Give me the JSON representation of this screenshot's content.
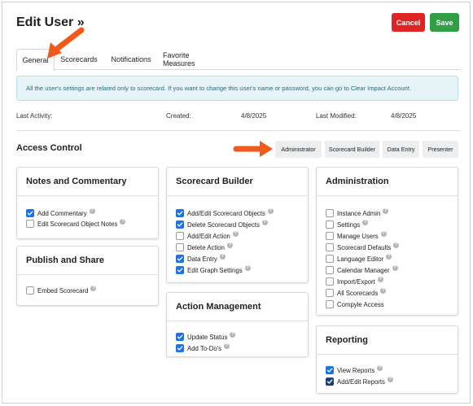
{
  "header": {
    "title": "Edit User »",
    "cancel_label": "Cancel",
    "save_label": "Save"
  },
  "tabs": [
    {
      "label": "General",
      "active": true
    },
    {
      "label": "Scorecards",
      "active": false
    },
    {
      "label": "Notifications",
      "active": false
    },
    {
      "label": "Favorite Measures",
      "active": false
    }
  ],
  "info_text": "All the user's settings are related only to scorecard. If you want to change this user's name or password, you can go to Clear Impact Account.",
  "meta": {
    "last_activity_label": "Last Activity:",
    "created_label": "Created:",
    "created_value": "4/8/2025",
    "last_modified_label": "Last Modified:",
    "last_modified_value": "4/8/2025"
  },
  "access_control": {
    "title": "Access Control",
    "roles": [
      "Administrator",
      "Scorecard Builder",
      "Data Entry",
      "Presenter"
    ]
  },
  "cards": {
    "notes": {
      "title": "Notes and Commentary",
      "items": [
        {
          "label": "Add Commentary",
          "checked": true
        },
        {
          "label": "Edit Scorecard Object Notes",
          "checked": false
        }
      ]
    },
    "publish": {
      "title": "Publish and Share",
      "items": [
        {
          "label": "Embed Scorecard",
          "checked": false
        }
      ]
    },
    "builder": {
      "title": "Scorecard Builder",
      "items": [
        {
          "label": "Add/Edit Scorecard Objects",
          "checked": true
        },
        {
          "label": "Delete Scorecard Objects",
          "checked": true
        },
        {
          "label": "Add/Edit Action",
          "checked": false
        },
        {
          "label": "Delete Action",
          "checked": false
        },
        {
          "label": "Data Entry",
          "checked": true
        },
        {
          "label": "Edit Graph Settings",
          "checked": true
        }
      ]
    },
    "action": {
      "title": "Action Management",
      "items": [
        {
          "label": "Update Status",
          "checked": true
        },
        {
          "label": "Add To-Do's",
          "checked": true
        }
      ]
    },
    "admin": {
      "title": "Administration",
      "items": [
        {
          "label": "Instance Admin",
          "checked": false
        },
        {
          "label": "Settings",
          "checked": false
        },
        {
          "label": "Manage Users",
          "checked": false
        },
        {
          "label": "Scorecard Defaults",
          "checked": false
        },
        {
          "label": "Language Editor",
          "checked": false
        },
        {
          "label": "Calendar Manager",
          "checked": false
        },
        {
          "label": "Import/Export",
          "checked": false
        },
        {
          "label": "All Scorecards",
          "checked": false
        },
        {
          "label": "Compyle Access",
          "checked": false
        }
      ]
    },
    "reporting": {
      "title": "Reporting",
      "items": [
        {
          "label": "View Reports",
          "checked": true
        },
        {
          "label": "Add/Edit Reports",
          "checked": true
        }
      ]
    }
  },
  "colors": {
    "cancel": "#e02424",
    "save": "#2f9e44",
    "checkbox_on": "#1a73e8",
    "info_bg": "#e6f4f7",
    "arrow": "#f05a1a"
  }
}
